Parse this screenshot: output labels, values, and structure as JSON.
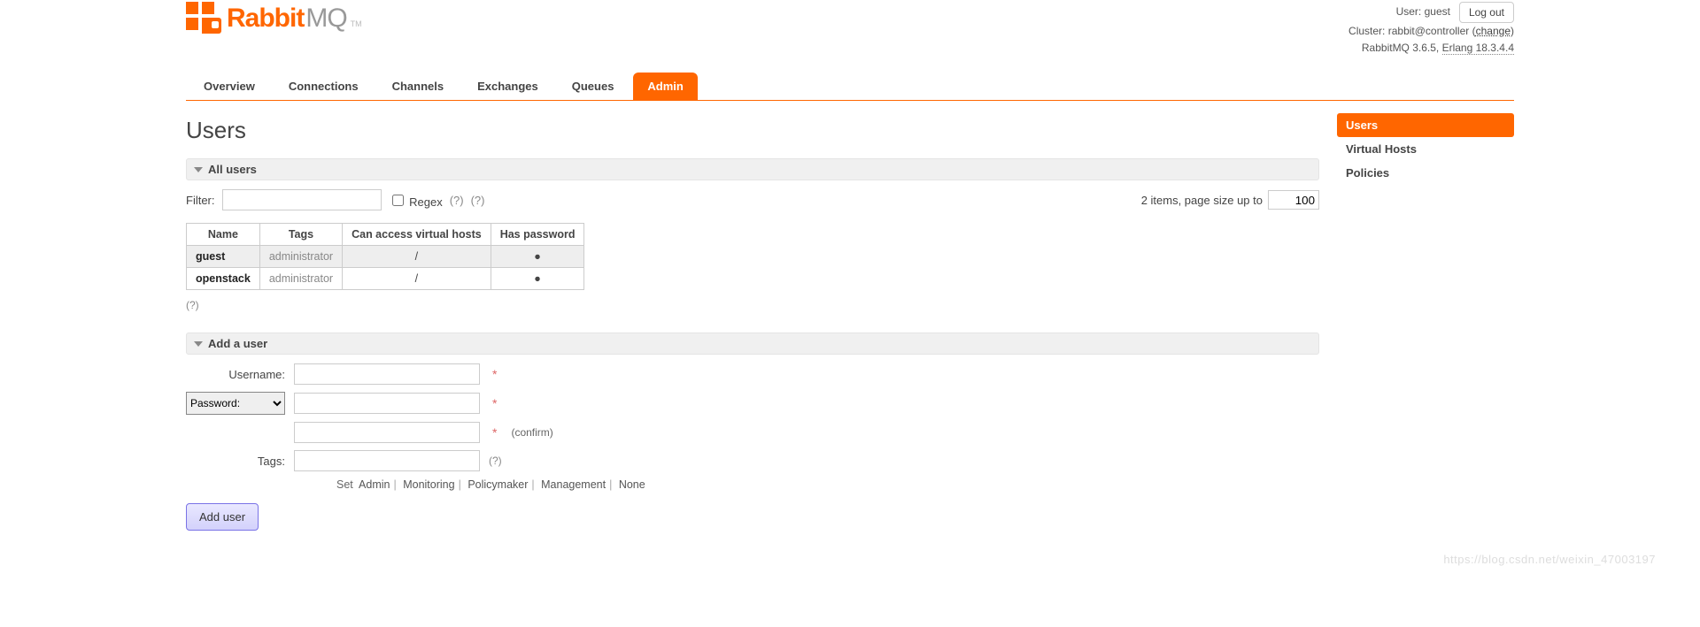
{
  "logo": {
    "text_a": "Rabbit",
    "text_b": "MQ",
    "tm": "TM"
  },
  "top": {
    "user_label": "User:",
    "user_value": "guest",
    "logout": "Log out",
    "cluster_label": "Cluster:",
    "cluster_value": "rabbit@controller",
    "cluster_change": "change",
    "version_prefix": "RabbitMQ 3.6.5,",
    "erlang_label": "Erlang 18.3.4.4"
  },
  "tabs": [
    {
      "label": "Overview",
      "active": false
    },
    {
      "label": "Connections",
      "active": false
    },
    {
      "label": "Channels",
      "active": false
    },
    {
      "label": "Exchanges",
      "active": false
    },
    {
      "label": "Queues",
      "active": false
    },
    {
      "label": "Admin",
      "active": true
    }
  ],
  "sidebar": [
    {
      "label": "Users",
      "active": true
    },
    {
      "label": "Virtual Hosts",
      "active": false
    },
    {
      "label": "Policies",
      "active": false
    }
  ],
  "page_title": "Users",
  "section_all_users": "All users",
  "filter": {
    "label": "Filter:",
    "value": "",
    "regex_label": "Regex",
    "help1": "(?)",
    "help2": "(?)"
  },
  "pager": {
    "text_prefix": "2 items, page size up to",
    "page_size": "100"
  },
  "users_table": {
    "headers": [
      "Name",
      "Tags",
      "Can access virtual hosts",
      "Has password"
    ],
    "rows": [
      {
        "name": "guest",
        "tags": "administrator",
        "vhosts": "/",
        "has_password": "●",
        "selected": true
      },
      {
        "name": "openstack",
        "tags": "administrator",
        "vhosts": "/",
        "has_password": "●",
        "selected": false
      }
    ]
  },
  "help_below_table": "(?)",
  "section_add_user": "Add a user",
  "add_user_form": {
    "username_label": "Username:",
    "username_value": "",
    "password_select": "Password:",
    "password_value": "",
    "confirm_value": "",
    "confirm_note": "(confirm)",
    "tags_label": "Tags:",
    "tags_value": "",
    "tags_help": "(?)",
    "set_prefix": "Set",
    "set_options": [
      "Admin",
      "Monitoring",
      "Policymaker",
      "Management",
      "None"
    ],
    "submit": "Add user"
  },
  "watermark": "https://blog.csdn.net/weixin_47003197"
}
